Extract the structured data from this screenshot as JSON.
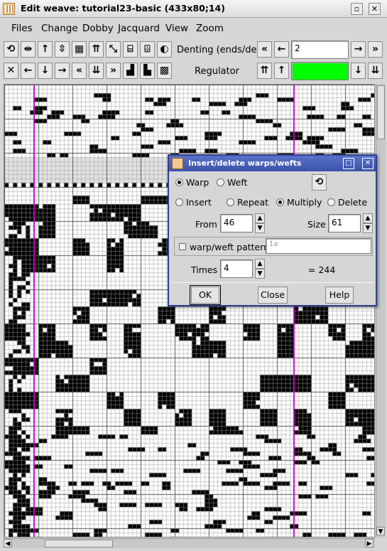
{
  "window": {
    "title": "Edit weave: tutorial23-basic (433x80;14)"
  },
  "menu": [
    "Files",
    "Change",
    "Dobby",
    "Jacquard",
    "View",
    "Zoom"
  ],
  "toolbar": {
    "row1_icons": [
      "rotate-icon",
      "flip-horizontal-icon",
      "arrow-up-icon",
      "flip-vertical-icon",
      "invert-icon",
      "double-up-icon",
      "diagonal-icon",
      "step-up-icon",
      "step-down-icon",
      "half-icon"
    ],
    "row2_icons": [
      "close-x-icon",
      "arrow-left-icon",
      "arrow-down-icon",
      "arrow-right-icon",
      "double-left-icon",
      "double-down-icon",
      "double-right-icon",
      "staircase-icon",
      "staircase-down-icon",
      "checker-icon"
    ],
    "denting_label": "Denting (ends/dent)",
    "denting_value": "2",
    "regulator_label": "Regulator",
    "regulator_color": "#00ff00"
  },
  "dialog": {
    "title": "Insert/delete warps/wefts",
    "target_options": [
      "Warp",
      "Weft"
    ],
    "target_selected": "Warp",
    "operations": [
      "Insert",
      "Repeat",
      "Multiply",
      "Delete"
    ],
    "operation_selected": "Multiply",
    "from_label": "From",
    "from_value": "46",
    "size_label": "Size",
    "size_value": "61",
    "pattern_label": "warp/weft pattern",
    "pattern_value": "1a",
    "times_label": "Times",
    "times_value": "4",
    "result_text": "= 244",
    "ok_label": "OK",
    "close_label": "Close",
    "help_label": "Help"
  },
  "grid": {
    "marker_color": "#cc00cc",
    "fill_color": "#000000"
  }
}
